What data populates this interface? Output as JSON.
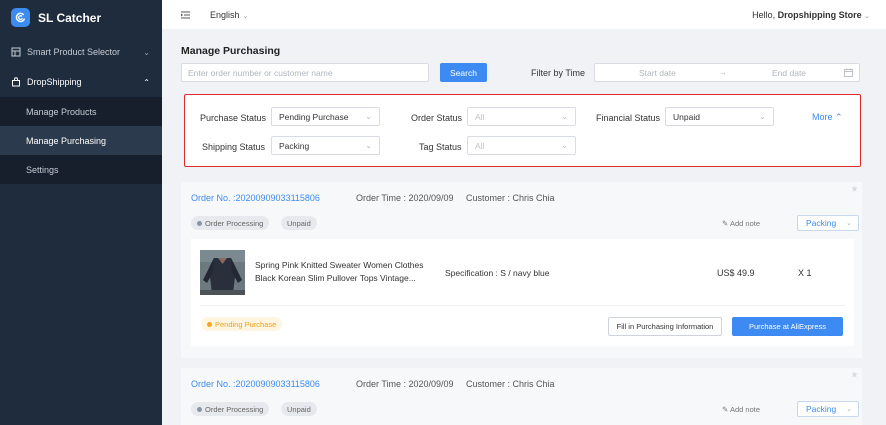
{
  "app": {
    "name": "SL Catcher",
    "logo_icon": "sl-catcher-logo",
    "accent": "#3d8bf2"
  },
  "sidebar": {
    "items": [
      {
        "label": "Smart Product Selector",
        "icon": "grid-icon",
        "chevron": "⌄"
      },
      {
        "label": "DropShipping",
        "icon": "bag-icon",
        "chevron": "⌃"
      }
    ],
    "submenu": [
      {
        "label": "Manage Products"
      },
      {
        "label": "Manage Purchasing",
        "active": true
      },
      {
        "label": "Settings"
      }
    ]
  },
  "topbar": {
    "language": "English",
    "hello_prefix": "Hello,",
    "user": "Dropshipping Store"
  },
  "page": {
    "title": "Manage Purchasing",
    "search_placeholder": "Enter order number or customer name",
    "search_button": "Search",
    "filter_time_label": "Filter by Time",
    "start_date": "Start date",
    "date_arrow": "→",
    "end_date": "End date"
  },
  "filters": {
    "purchase_status": {
      "label": "Purchase Status",
      "value": "Pending Purchase"
    },
    "order_status": {
      "label": "Order Status",
      "value": "All"
    },
    "financial_status": {
      "label": "Financial Status",
      "value": "Unpaid"
    },
    "shipping_status": {
      "label": "Shipping Status",
      "value": "Packing"
    },
    "tag_status": {
      "label": "Tag Status",
      "value": "All"
    },
    "more": "More"
  },
  "orders": [
    {
      "order_no": "Order No. :20200909033115806",
      "order_time": "Order Time : 2020/09/09",
      "customer": "Customer : Chris Chia",
      "status_tag": "Order Processing",
      "payment_tag": "Unpaid",
      "add_note": "Add note",
      "shipping": "Packing",
      "product_title": "Spring Pink Knitted Sweater Women Clothes Black Korean Slim Pullover Tops Vintage...",
      "specification": "Specification : S / navy blue",
      "price": "US$ 49.9",
      "qty": "X 1",
      "purchase_tag": "Pending Purchase",
      "fill_button": "Fill in Purchasing Information",
      "buy_button": "Purchase at AliExpress"
    },
    {
      "order_no": "Order No. :20200909033115806",
      "order_time": "Order Time : 2020/09/09",
      "customer": "Customer : Chris Chia",
      "status_tag": "Order Processing",
      "payment_tag": "Unpaid",
      "add_note": "Add note",
      "shipping": "Packing"
    }
  ]
}
